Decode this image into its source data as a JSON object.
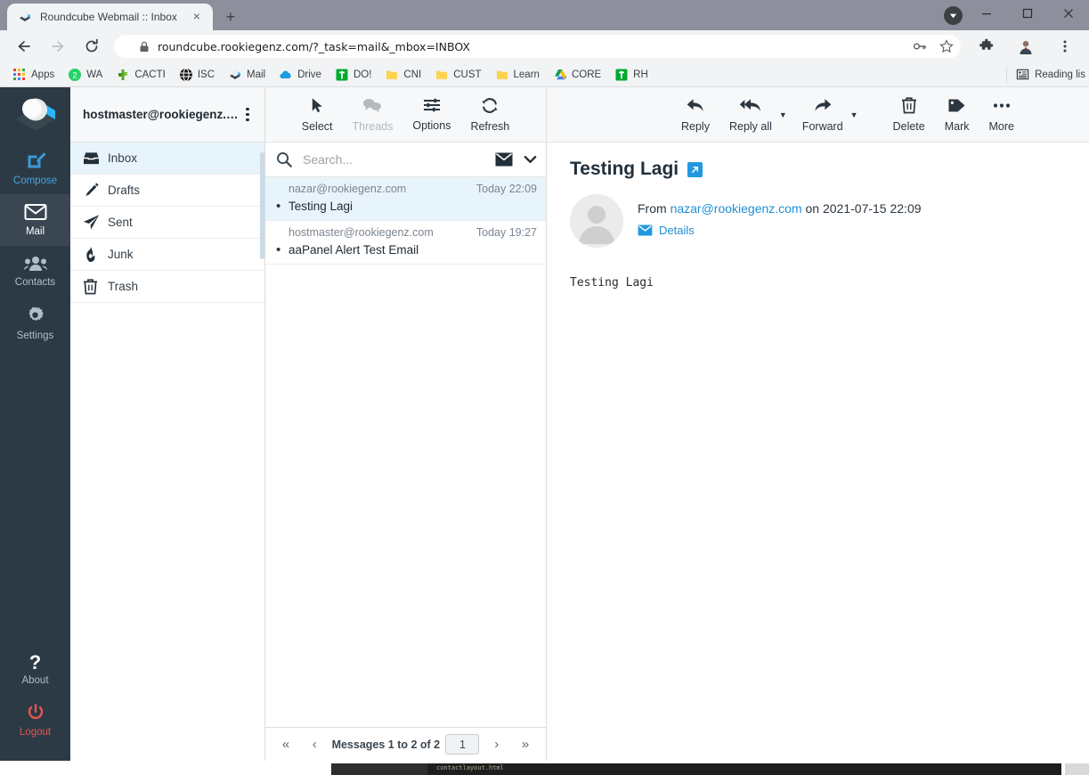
{
  "browser": {
    "tab": {
      "title": "Roundcube Webmail :: Inbox",
      "favicon": "roundcube-favicon",
      "close_label": "×"
    },
    "new_tab_label": "+",
    "window_controls": {
      "minimize": "—",
      "maximize": "□",
      "close": "✕"
    },
    "nav": {
      "back": "←",
      "forward": "→",
      "reload": "↻"
    },
    "omnibox": {
      "url": "roundcube.rookiegenz.com/?_task=mail&_mbox=INBOX",
      "lock_icon": "lock-icon",
      "password_icon": "key-icon",
      "bookmark_icon": "star-icon"
    },
    "extensions_icon": "puzzle-icon",
    "profile_icon": "avatar-icon",
    "menu_icon": "kebab-menu-icon",
    "download_icon": "download-bubble-icon",
    "bookmarks": [
      {
        "label": "Apps",
        "icon": "apps-grid-icon"
      },
      {
        "label": "WA",
        "icon": "whatsapp-icon"
      },
      {
        "label": "CACTI",
        "icon": "cacti-icon"
      },
      {
        "label": "ISC",
        "icon": "globe-dark-icon"
      },
      {
        "label": "Mail",
        "icon": "roundcube-icon"
      },
      {
        "label": "Drive",
        "icon": "onedrive-cloud-icon"
      },
      {
        "label": "DO!",
        "icon": "evernote-icon"
      },
      {
        "label": "CNI",
        "icon": "folder-icon"
      },
      {
        "label": "CUST",
        "icon": "folder-icon"
      },
      {
        "label": "Learn",
        "icon": "folder-icon"
      },
      {
        "label": "CORE",
        "icon": "google-drive-icon"
      },
      {
        "label": "RH",
        "icon": "evernote-icon"
      }
    ],
    "reading_list": {
      "label": "Reading lis",
      "icon": "reading-list-icon"
    }
  },
  "taskmenu": {
    "logo": "roundcube-logo",
    "items": [
      {
        "label": "Compose",
        "icon": "compose-icon",
        "state": "accent"
      },
      {
        "label": "Mail",
        "icon": "envelope-icon",
        "state": "selected"
      },
      {
        "label": "Contacts",
        "icon": "contacts-icon",
        "state": "normal"
      },
      {
        "label": "Settings",
        "icon": "gear-icon",
        "state": "normal"
      }
    ],
    "bottom_items": [
      {
        "label": "About",
        "icon": "question-mark-icon",
        "state": "normal"
      },
      {
        "label": "Logout",
        "icon": "power-icon",
        "state": "logout"
      }
    ]
  },
  "folders": {
    "account": "hostmaster@rookiegenz.c...",
    "options_icon": "kebab-menu-icon",
    "items": [
      {
        "label": "Inbox",
        "icon": "inbox-icon",
        "active": true
      },
      {
        "label": "Drafts",
        "icon": "pencil-icon",
        "active": false
      },
      {
        "label": "Sent",
        "icon": "paper-plane-icon",
        "active": false
      },
      {
        "label": "Junk",
        "icon": "fire-icon",
        "active": false
      },
      {
        "label": "Trash",
        "icon": "trash-icon",
        "active": false
      }
    ]
  },
  "list_toolbar": [
    {
      "label": "Select",
      "icon": "cursor-arrow-icon",
      "disabled": false
    },
    {
      "label": "Threads",
      "icon": "speech-bubbles-icon",
      "disabled": true
    },
    {
      "label": "Options",
      "icon": "sliders-icon",
      "disabled": false
    },
    {
      "label": "Refresh",
      "icon": "refresh-icon",
      "disabled": false
    }
  ],
  "search": {
    "placeholder": "Search...",
    "value": "",
    "search_icon": "search-icon",
    "scope_icon": "envelope-icon",
    "chevron_icon": "chevron-down-icon"
  },
  "messages": [
    {
      "from": "nazar@rookiegenz.com",
      "date": "Today 22:09",
      "subject": "Testing Lagi",
      "unread": true,
      "selected": true
    },
    {
      "from": "hostmaster@rookiegenz.com",
      "date": "Today 19:27",
      "subject": "aaPanel Alert Test Email",
      "unread": true,
      "selected": false
    }
  ],
  "pagination": {
    "first_icon": "«",
    "prev_icon": "‹",
    "status": "Messages 1 to 2 of 2",
    "page_value": "1",
    "next_icon": "›",
    "last_icon": "»"
  },
  "viewer_toolbar": [
    {
      "label": "Reply",
      "icon": "reply-icon",
      "has_caret": false
    },
    {
      "label": "Reply all",
      "icon": "reply-all-icon",
      "has_caret": true
    },
    {
      "label": "Forward",
      "icon": "forward-icon",
      "has_caret": true
    },
    {
      "label": "Delete",
      "icon": "trash-icon",
      "has_caret": false
    },
    {
      "label": "Mark",
      "icon": "tag-icon",
      "has_caret": false
    },
    {
      "label": "More",
      "icon": "ellipsis-icon",
      "has_caret": false
    }
  ],
  "message": {
    "subject": "Testing Lagi",
    "open_window_icon": "external-link-icon",
    "avatar_icon": "user-avatar-placeholder",
    "from_prefix": "From",
    "from_address": "nazar@rookiegenz.com",
    "on_prefix": "on",
    "datetime": "2021-07-15 22:09",
    "details_label": "Details",
    "details_icon": "envelope-icon",
    "body": "Testing Lagi"
  },
  "colors": {
    "task_bg": "#2c3a46",
    "task_selected": "#3a4651",
    "accent_blue": "#1e8fd5",
    "selected_row": "#e8f4fb",
    "logout_red": "#e8544d",
    "toolbar_bg": "#f7f8f9"
  },
  "bottom_window": {
    "filename": "contactlayout.html"
  }
}
